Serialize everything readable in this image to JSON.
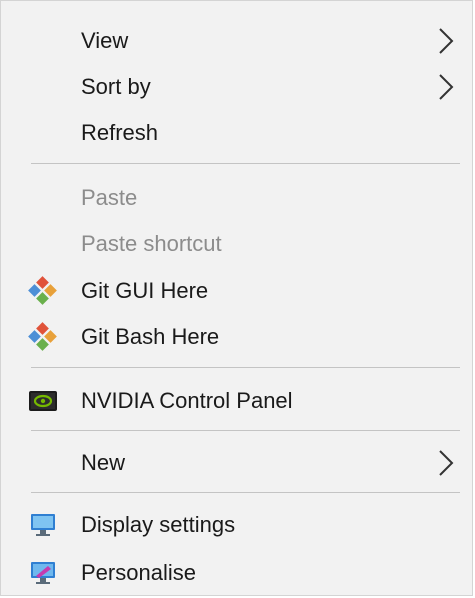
{
  "context_menu": {
    "items": [
      {
        "label": "View",
        "icon": "",
        "submenu": true,
        "disabled": false
      },
      {
        "label": "Sort by",
        "icon": "",
        "submenu": true,
        "disabled": false
      },
      {
        "label": "Refresh",
        "icon": "",
        "submenu": false,
        "disabled": false
      },
      {
        "label": "Paste",
        "icon": "",
        "submenu": false,
        "disabled": true
      },
      {
        "label": "Paste shortcut",
        "icon": "",
        "submenu": false,
        "disabled": true
      },
      {
        "label": "Git GUI Here",
        "icon": "git-gui-icon",
        "submenu": false,
        "disabled": false
      },
      {
        "label": "Git Bash Here",
        "icon": "git-bash-icon",
        "submenu": false,
        "disabled": false
      },
      {
        "label": "NVIDIA Control Panel",
        "icon": "nvidia-icon",
        "submenu": false,
        "disabled": false
      },
      {
        "label": "New",
        "icon": "",
        "submenu": true,
        "disabled": false
      },
      {
        "label": "Display settings",
        "icon": "display-settings-icon",
        "submenu": false,
        "disabled": false
      },
      {
        "label": "Personalise",
        "icon": "personalise-icon",
        "submenu": false,
        "disabled": false
      }
    ]
  },
  "colors": {
    "menu_background": "#f2f2f2",
    "text": "#1a1a1a",
    "disabled_text": "#8c8c8c",
    "separator": "#c4c4c4"
  }
}
